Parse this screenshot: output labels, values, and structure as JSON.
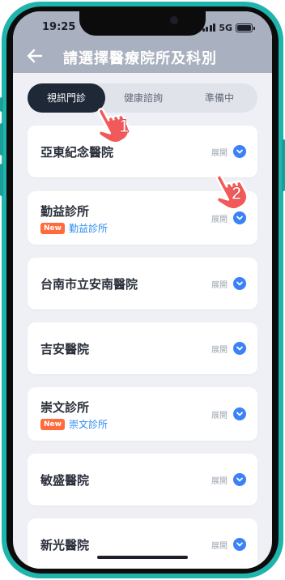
{
  "status_bar": {
    "time": "19:25",
    "network": "5G",
    "battery_level": 1.0
  },
  "nav": {
    "title": "請選擇醫療院所及科別"
  },
  "tabs": [
    {
      "label": "視訊門診",
      "active": true
    },
    {
      "label": "健康諮詢",
      "active": false
    },
    {
      "label": "準備中",
      "active": false
    }
  ],
  "expand_label": "展開",
  "clinics": [
    {
      "name": "亞東紀念醫院"
    },
    {
      "name": "勤益診所",
      "badge": "New",
      "sub": "勤益診所"
    },
    {
      "name": "台南市立安南醫院"
    },
    {
      "name": "吉安醫院"
    },
    {
      "name": "崇文診所",
      "badge": "New",
      "sub": "崇文診所"
    },
    {
      "name": "敏盛醫院"
    },
    {
      "name": "新光醫院"
    }
  ],
  "steps": [
    "1",
    "2"
  ],
  "colors": {
    "phone_frame": "#1fb5ad",
    "header": "#a9b0bf",
    "active_tab": "#1f2836",
    "accent_blue": "#3b82f6",
    "new_badge": "#ff6b3d",
    "pointer_red": "#e24a4a"
  }
}
